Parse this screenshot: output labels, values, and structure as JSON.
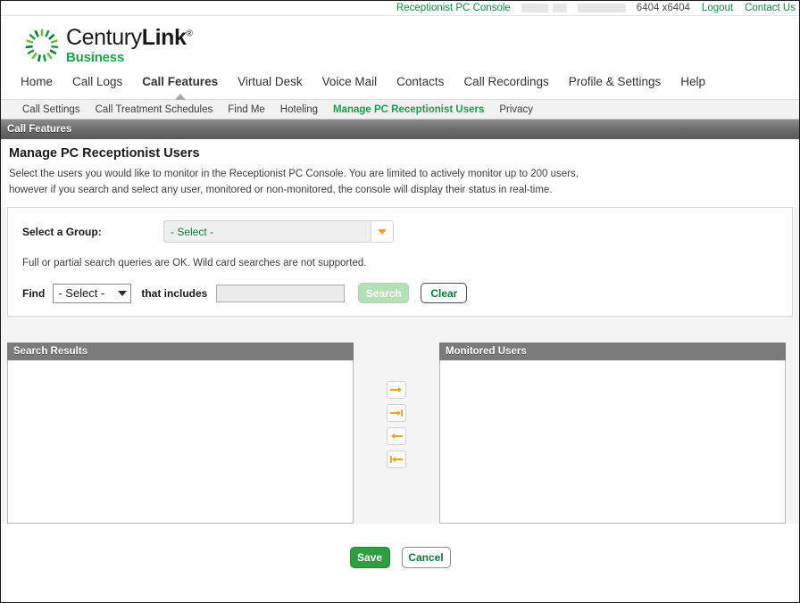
{
  "topbar": {
    "console_link": "Receptionist PC Console",
    "account": "6404 x6404",
    "logout": "Logout",
    "contact": "Contact Us"
  },
  "brand": {
    "name": "CenturyLink",
    "trademark": "®",
    "tagline": "Business"
  },
  "mainnav": {
    "items": [
      {
        "label": "Home",
        "active": false
      },
      {
        "label": "Call Logs",
        "active": false
      },
      {
        "label": "Call Features",
        "active": true
      },
      {
        "label": "Virtual Desk",
        "active": false
      },
      {
        "label": "Voice Mail",
        "active": false
      },
      {
        "label": "Contacts",
        "active": false
      },
      {
        "label": "Call Recordings",
        "active": false
      },
      {
        "label": "Profile & Settings",
        "active": false
      },
      {
        "label": "Help",
        "active": false
      }
    ]
  },
  "subnav": {
    "items": [
      {
        "label": "Call Settings",
        "active": false
      },
      {
        "label": "Call Treatment Schedules",
        "active": false
      },
      {
        "label": "Find Me",
        "active": false
      },
      {
        "label": "Hoteling",
        "active": false
      },
      {
        "label": "Manage PC Receptionist Users",
        "active": true
      },
      {
        "label": "Privacy",
        "active": false
      }
    ]
  },
  "section": {
    "bar_title": "Call Features",
    "page_title": "Manage PC Receptionist Users",
    "description_line1": "Select the users you would like to monitor in the Receptionist PC Console. You are limited to actively monitor up to 200 users,",
    "description_line2": "however if you search and select any user, monitored or non-monitored, the console will display their status in real-time."
  },
  "form": {
    "group_label": "Select a Group:",
    "group_value": "- Select -",
    "hint": "Full or partial search queries are OK. Wild card searches are not supported.",
    "find_label": "Find",
    "find_value": "- Select -",
    "includes_label": "that includes",
    "search_value": "",
    "search_placeholder": "",
    "search_button": "Search",
    "clear_button": "Clear"
  },
  "lists": {
    "search_results_title": "Search Results",
    "monitored_users_title": "Monitored Users",
    "search_results_items": [],
    "monitored_users_items": []
  },
  "transfer_buttons": [
    {
      "name": "move-right-icon"
    },
    {
      "name": "move-all-right-icon"
    },
    {
      "name": "move-left-icon"
    },
    {
      "name": "move-all-left-icon"
    }
  ],
  "footer": {
    "save": "Save",
    "cancel": "Cancel"
  },
  "colors": {
    "brand_green": "#18a64a",
    "link_green": "#0b8a42",
    "accent_orange": "#f0a024",
    "header_gray": "#7b7b7b",
    "page_bg": "#f4f4f4"
  }
}
